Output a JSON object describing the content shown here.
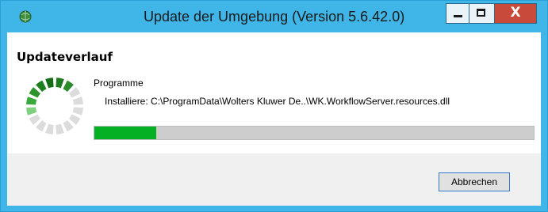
{
  "window": {
    "title": "Update der Umgebung (Version 5.6.42.0)",
    "app_icon": "globe-icon",
    "controls": {
      "minimize_icon": "minimize-icon",
      "maximize_icon": "maximize-icon",
      "close_icon": "close-icon",
      "close_glyph": "X"
    },
    "colors": {
      "titlebar": "#40b6e8",
      "close": "#c74a3a"
    }
  },
  "main": {
    "heading": "Updateverlauf",
    "spinner_icon": "loading-spinner-icon",
    "section": "Programme",
    "detail": "Installiere: C:\\ProgramData\\Wolters Kluwer De..\\WK.WorkflowServer.resources.dll",
    "progress": {
      "fraction": 0.14,
      "color": "#06b025"
    }
  },
  "footer": {
    "cancel_label": "Abbrechen"
  }
}
